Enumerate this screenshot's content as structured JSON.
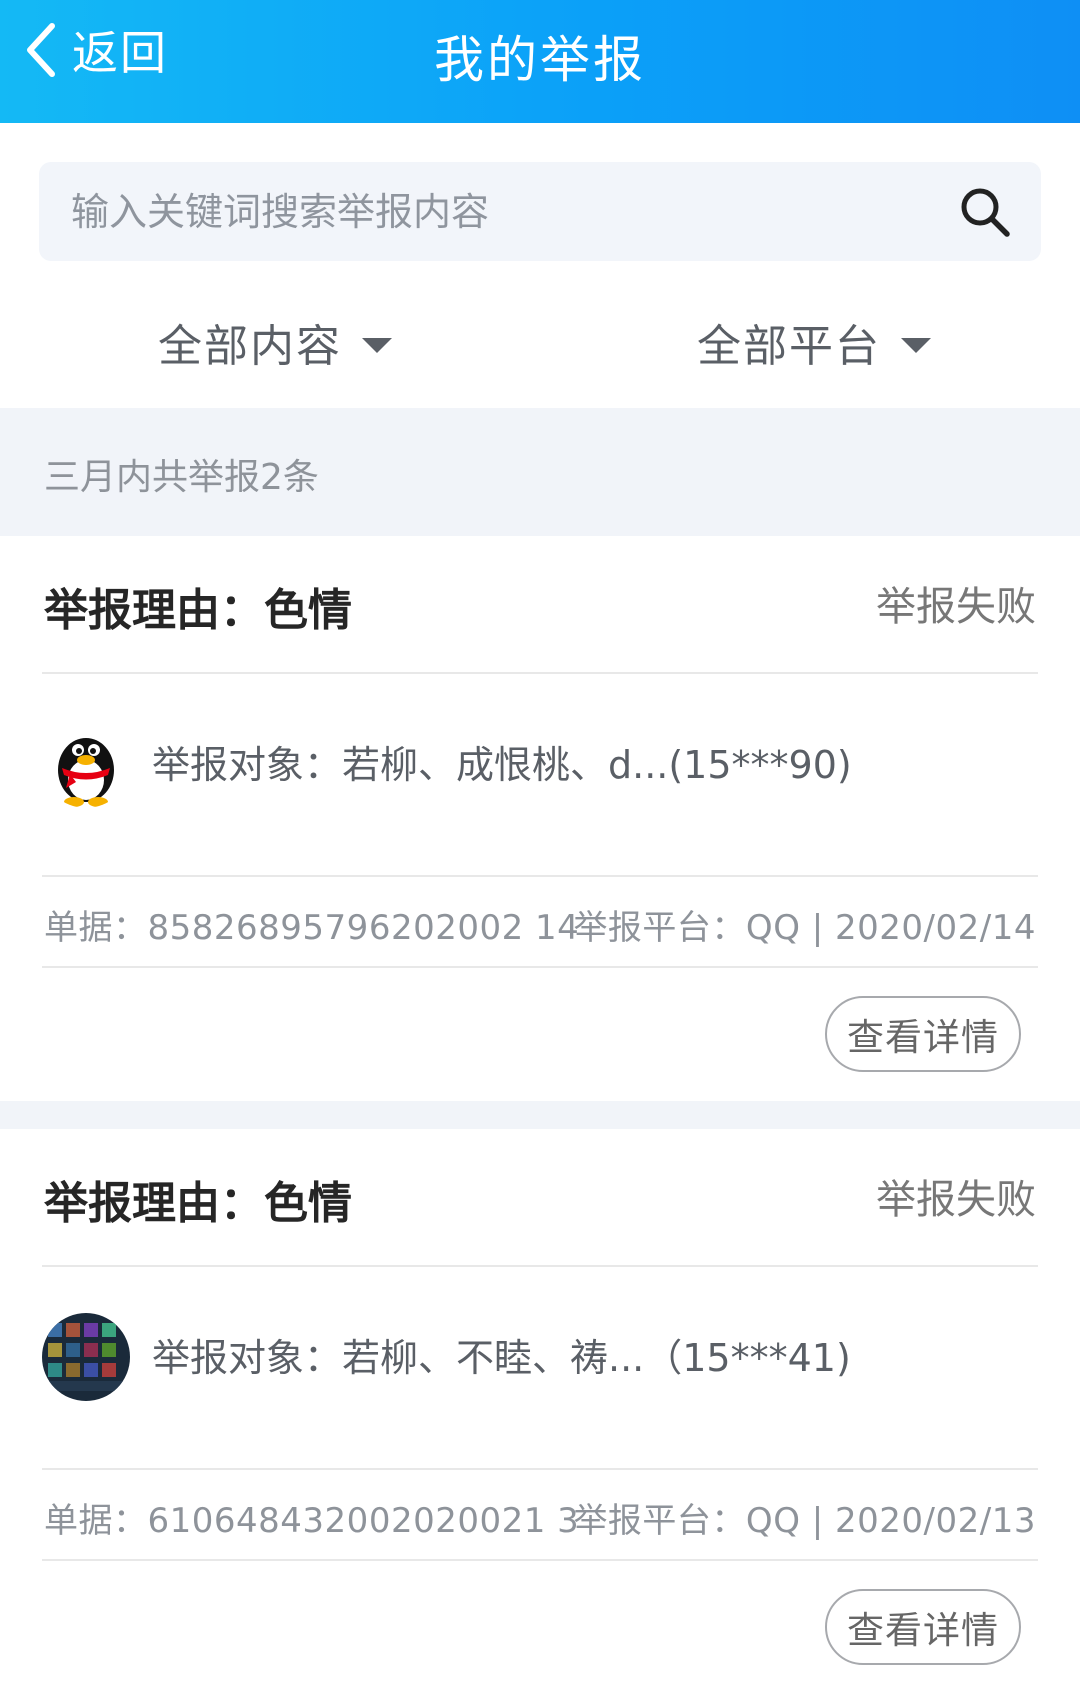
{
  "header": {
    "back_label": "返回",
    "title": "我的举报"
  },
  "search": {
    "placeholder": "输入关键词搜索举报内容"
  },
  "filters": {
    "content": "全部内容",
    "platform": "全部平台"
  },
  "summary": "三月内共举报2条",
  "records": [
    {
      "reason": "举报理由：色情",
      "status": "举报失败",
      "avatar": "qq-penguin-icon",
      "target": "举报对象：若柳、成恨桃、d...(15***90)",
      "ticket": "单据：85826895796202002 14",
      "platform_date": "举报平台：QQ | 2020/02/14",
      "detail_label": "查看详情"
    },
    {
      "reason": "举报理由：色情",
      "status": "举报失败",
      "avatar": "game-screenshot-avatar",
      "target": "举报对象：若柳、不睦、祷...（15***41)",
      "ticket": "单据：610648432002020021 3",
      "platform_date": "举报平台：QQ | 2020/02/13",
      "detail_label": "查看详情"
    }
  ],
  "colors": {
    "header_start": "#14b9f5",
    "header_end": "#0e8ff5",
    "band": "#f1f4f9"
  }
}
